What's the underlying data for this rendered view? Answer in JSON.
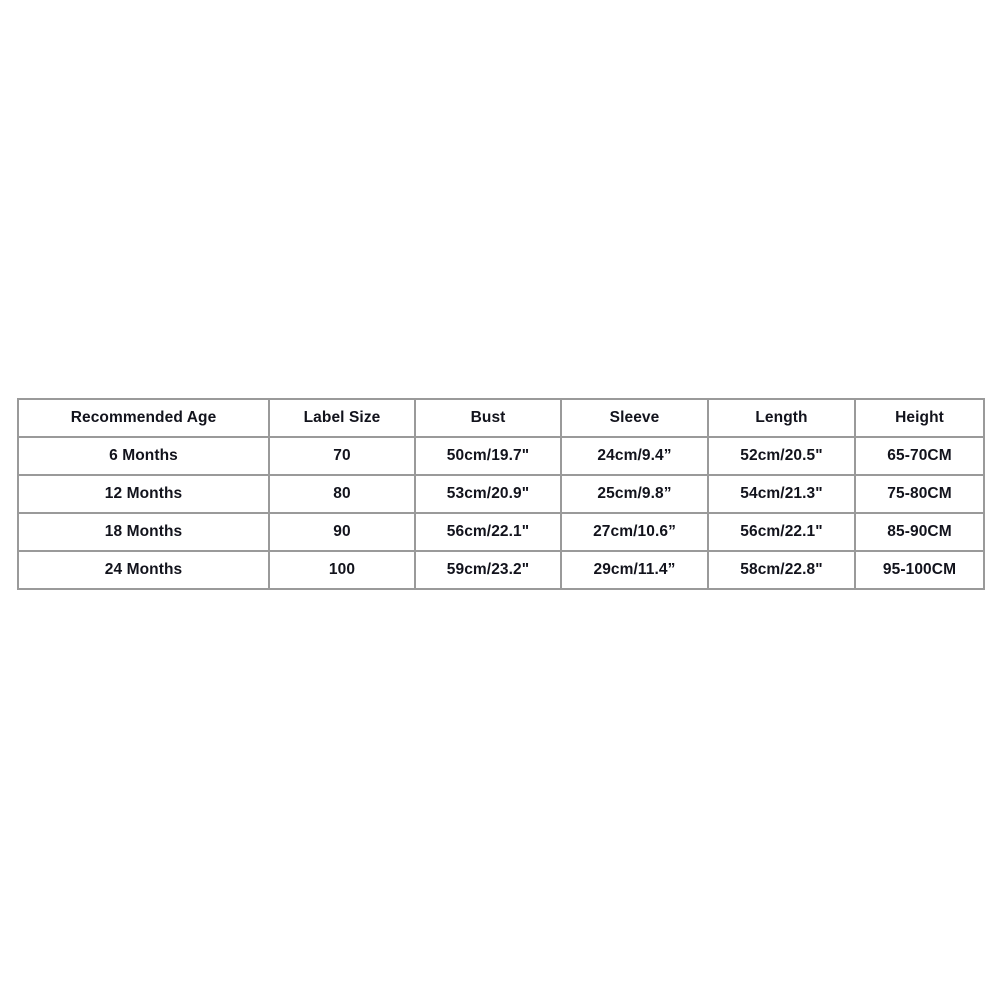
{
  "table": {
    "columns": [
      "Recommended Age",
      "Label Size",
      "Bust",
      "Sleeve",
      "Length",
      "Height"
    ],
    "rows": [
      {
        "age": "6 Months",
        "label_size": "70",
        "bust": "50cm/19.7\"",
        "sleeve": "24cm/9.4”",
        "length": "52cm/20.5\"",
        "height": "65-70CM"
      },
      {
        "age": "12 Months",
        "label_size": "80",
        "bust": "53cm/20.9\"",
        "sleeve": "25cm/9.8”",
        "length": "54cm/21.3\"",
        "height": "75-80CM"
      },
      {
        "age": "18 Months",
        "label_size": "90",
        "bust": "56cm/22.1\"",
        "sleeve": "27cm/10.6”",
        "length": "56cm/22.1\"",
        "height": "85-90CM"
      },
      {
        "age": "24 Months",
        "label_size": "100",
        "bust": "59cm/23.2\"",
        "sleeve": "29cm/11.4”",
        "length": "58cm/22.8\"",
        "height": "95-100CM"
      }
    ]
  },
  "style": {
    "border_color": "#9a9a9a",
    "text_color": "#12131c",
    "background_color": "#ffffff"
  }
}
